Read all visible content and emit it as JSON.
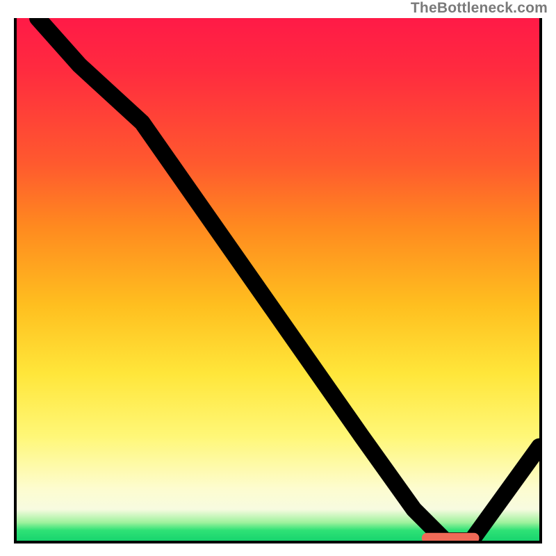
{
  "watermark": "TheBottleneck.com",
  "chart_data": {
    "type": "line",
    "title": "",
    "xlabel": "",
    "ylabel": "",
    "xlim": [
      0,
      100
    ],
    "ylim": [
      0,
      100
    ],
    "x": [
      4,
      12,
      24,
      38,
      52,
      66,
      76,
      82,
      87,
      100
    ],
    "values": [
      100,
      91,
      80,
      60,
      40,
      20,
      6,
      0,
      0,
      18
    ],
    "marker": {
      "x_start": 78,
      "x_end": 88,
      "y": 0
    },
    "gradient_stops": [
      {
        "pos": 0,
        "color": "#ff1a47"
      },
      {
        "pos": 0.55,
        "color": "#ffbf1f"
      },
      {
        "pos": 0.8,
        "color": "#fff777"
      },
      {
        "pos": 0.96,
        "color": "#9ff29d"
      },
      {
        "pos": 1.0,
        "color": "#18d46e"
      }
    ]
  }
}
